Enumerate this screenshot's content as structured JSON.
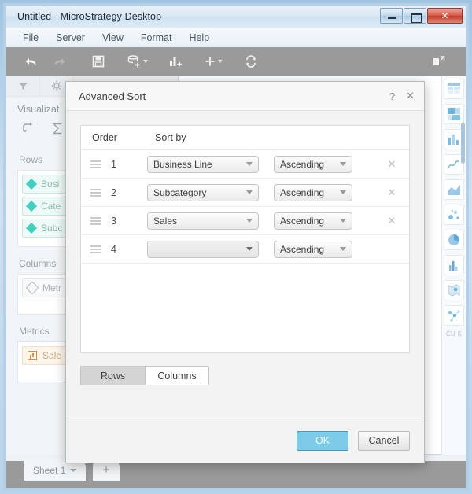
{
  "window": {
    "title": "Untitled - MicroStrategy Desktop",
    "controls": {
      "minimize": "minimize-button",
      "maximize": "maximize-button",
      "close": "✕"
    }
  },
  "menu": {
    "items": [
      "File",
      "Server",
      "View",
      "Format",
      "Help"
    ]
  },
  "toolbar": {
    "items": [
      {
        "name": "undo-icon",
        "glyph": "↶",
        "enabled": true
      },
      {
        "name": "redo-icon",
        "glyph": "↷",
        "enabled": false
      },
      {
        "name": "save-icon",
        "glyph": "💾",
        "enabled": true
      },
      {
        "name": "add-data-icon",
        "glyph": "data",
        "enabled": true,
        "caret": true
      },
      {
        "name": "add-visualization-icon",
        "glyph": "chart",
        "enabled": true
      },
      {
        "name": "insert-icon",
        "glyph": "+",
        "enabled": true,
        "caret": true
      },
      {
        "name": "refresh-icon",
        "glyph": "↺",
        "enabled": true
      },
      {
        "name": "share-icon",
        "glyph": "share",
        "enabled": true
      }
    ]
  },
  "left_panel": {
    "tabs": [
      "filter-icon",
      "gear-icon"
    ],
    "title": "Visualizat",
    "tool_icons": [
      "swap-icon",
      "sigma-icon"
    ],
    "sections": [
      {
        "label": "Rows",
        "items": [
          {
            "label": "Busi",
            "type": "attribute"
          },
          {
            "label": "Cate",
            "type": "attribute"
          },
          {
            "label": "Subc",
            "type": "attribute"
          }
        ]
      },
      {
        "label": "Columns",
        "items": [
          {
            "label": "Metr",
            "type": "generic"
          }
        ]
      },
      {
        "label": "Metrics",
        "items": [
          {
            "label": "Sale",
            "type": "metric"
          }
        ]
      }
    ]
  },
  "right_panel": {
    "label": "CU S",
    "thumbnails": [
      "grid-visualization-thumb",
      "heatmap-visualization-thumb",
      "bar-visualization-thumb",
      "line-visualization-thumb",
      "area-visualization-thumb",
      "bubble-visualization-thumb",
      "pie-visualization-thumb",
      "histogram-visualization-thumb",
      "map-visualization-thumb",
      "network-visualization-thumb"
    ]
  },
  "sheet_bar": {
    "sheet_name": "Sheet 1",
    "add_label": "+"
  },
  "dialog": {
    "title": "Advanced Sort",
    "help_glyph": "?",
    "close_glyph": "✕",
    "headers": {
      "order": "Order",
      "sort_by": "Sort by"
    },
    "rows": [
      {
        "order": "1",
        "field": "Business Line",
        "direction": "Ascending",
        "removable": true
      },
      {
        "order": "2",
        "field": "Subcategory",
        "direction": "Ascending",
        "removable": true
      },
      {
        "order": "3",
        "field": "Sales",
        "direction": "Ascending",
        "removable": true
      },
      {
        "order": "4",
        "field": "",
        "direction": "Ascending",
        "removable": false
      }
    ],
    "remove_glyph": "✕",
    "toggle": {
      "rows_label": "Rows",
      "columns_label": "Columns",
      "selected": "Rows"
    },
    "footer": {
      "ok_label": "OK",
      "cancel_label": "Cancel"
    }
  },
  "colors": {
    "primary_button": "#7ecbe8",
    "attribute_chip": "#3fd0c0",
    "metric_chip": "#e08a42",
    "toolbar_bg": "#9a9a9a"
  }
}
